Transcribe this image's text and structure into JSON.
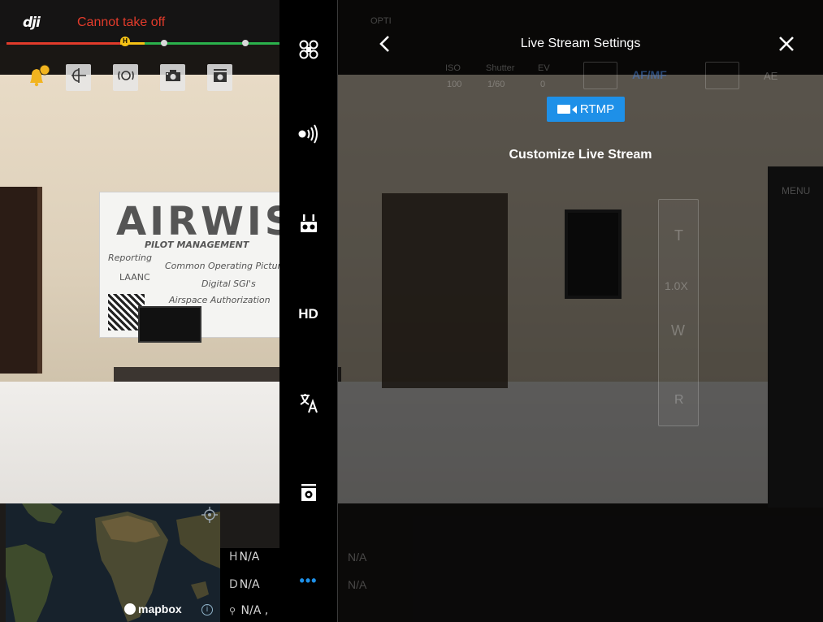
{
  "app": {
    "logo": "dji",
    "status": "Cannot take off",
    "status_marker": "H",
    "colors": {
      "status_red": "#e23b2b",
      "accent_blue": "#1e90e8",
      "bar_green": "#2bb24c",
      "bar_yellow": "#f5c215"
    }
  },
  "notification": {
    "badge_count": "0"
  },
  "hud_buttons": [
    {
      "icon": "obstacle-sensing-icon"
    },
    {
      "icon": "focus-target-icon"
    },
    {
      "icon": "camera-capture-icon"
    },
    {
      "icon": "camera-settings-icon"
    }
  ],
  "camera_overlay": {
    "ghost_labels": [
      "ISO",
      "Shutter",
      "EV",
      "100",
      "1/60",
      "0",
      "AF/MF",
      "AE",
      "T",
      "1.0X",
      "W",
      "R",
      "MENU",
      "OPTI"
    ]
  },
  "banner": {
    "brand": "AIRWIS",
    "lines": [
      "PILOT MANAGEMENT",
      "Reporting",
      "Common Operating Picture",
      "LAANC",
      "Digital SGI's",
      "Airspace Authorization"
    ]
  },
  "map": {
    "attribution": "mapbox",
    "info_symbol": "i"
  },
  "telemetry": {
    "h_label": "H",
    "h_value": "N/A",
    "d_label": "D",
    "d_value": "N/A",
    "gps_value": "N/A ,"
  },
  "sidebar": {
    "items": [
      {
        "icon": "aircraft-icon",
        "label": ""
      },
      {
        "icon": "signal-icon",
        "label": ""
      },
      {
        "icon": "remote-controller-icon",
        "label": ""
      },
      {
        "icon": "hd-video-icon",
        "label": "HD"
      },
      {
        "icon": "language-icon",
        "label": ""
      },
      {
        "icon": "camera-icon",
        "label": ""
      },
      {
        "icon": "more-icon",
        "label": "•••"
      }
    ]
  },
  "panel": {
    "title": "Live Stream Settings",
    "rtmp_label": "RTMP",
    "customize_label": "Customize Live Stream"
  }
}
